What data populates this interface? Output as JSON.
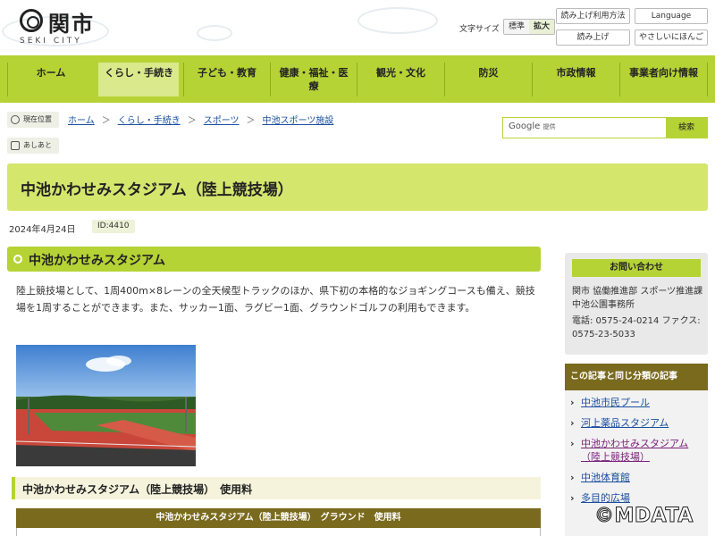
{
  "header": {
    "logo_name": "関市",
    "logo_sub": "SEKI CITY",
    "fontsize_label": "文字サイズ",
    "fontsize_options": [
      "標準",
      "拡大"
    ],
    "buttons": {
      "readaloud_howto": "読み上げ利用方法",
      "language": "Language",
      "readaloud": "読み上げ",
      "easy_japanese": "やさしいにほんご"
    }
  },
  "nav": {
    "items": [
      "ホーム",
      "くらし・手続き",
      "子ども・教育",
      "健康・福祉・医療",
      "観光・文化",
      "防災",
      "市政情報",
      "事業者向け情報"
    ]
  },
  "breadcrumb": {
    "current_label": "現在位置",
    "history_label": "あしあと",
    "items": [
      "ホーム",
      "くらし・手続き",
      "スポーツ",
      "中池スポーツ施設"
    ],
    "sep": "＞"
  },
  "search": {
    "google": "Google",
    "placeholder": "提供",
    "button": "検索"
  },
  "page": {
    "title": "中池かわせみスタジアム（陸上競技場）",
    "date": "2024年4月24日",
    "id": "ID:4410"
  },
  "main": {
    "section_title": "中池かわせみスタジアム",
    "body": "陸上競技場として、1周400m×8レーンの全天候型トラックのほか、県下初の本格的なジョギングコースも備え、競技場を1周することができます。また、サッカー1面、ラグビー1面、グラウンドゴルフの利用もできます。",
    "sub_title": "中池かわせみスタジアム（陸上競技場）　使用料",
    "table_caption": "中池かわせみスタジアム（陸上競技場）　グラウンド　使用料"
  },
  "sidebar": {
    "contact_title": "お問い合わせ",
    "contact_org": "関市 協働推進部 スポーツ推進課　中池公園事務所",
    "contact_tel": "電話: 0575-24-0214 ファクス: 0575-23-5033",
    "related_title": "この記事と同じ分類の記事",
    "related_items": [
      "中池市民プール",
      "河上薬品スタジアム",
      "中池かわせみスタジアム（陸上競技場）",
      "中池体育館",
      "多目的広場"
    ]
  },
  "watermark": "©MDATA",
  "colors": {
    "accent": "#b5d335",
    "title_bg": "#d5e66d",
    "brown": "#7a6a1e",
    "link": "#1a4fa0"
  }
}
